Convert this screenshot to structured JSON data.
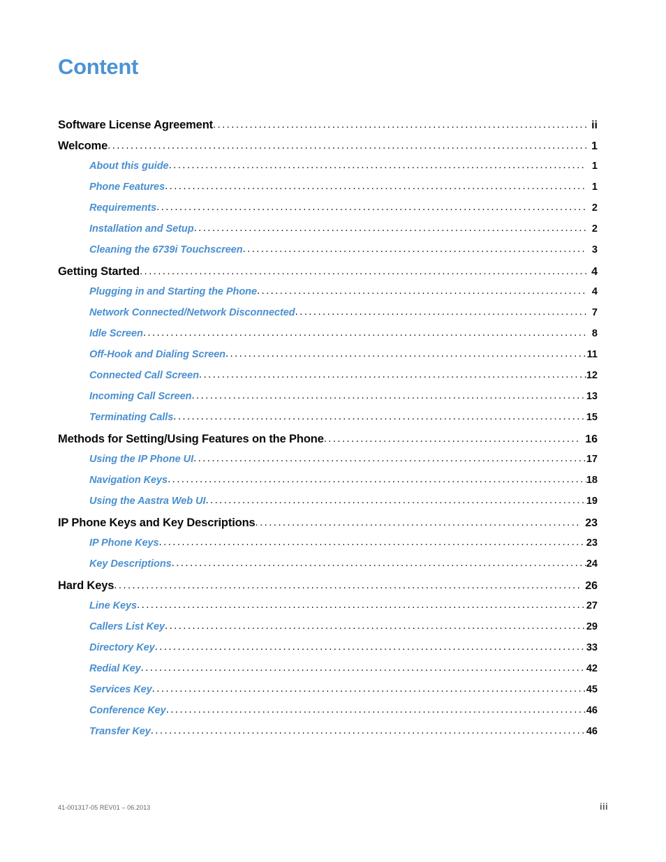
{
  "page": {
    "title": "Content",
    "title_color": "#4c93d3",
    "link_color": "#4a8fd0",
    "heading_color": "#0a0a0a",
    "background": "#ffffff"
  },
  "toc": {
    "entries": [
      {
        "level": 1,
        "label": "Software License Agreement",
        "page": "ii",
        "gap_before_page": false
      },
      {
        "level": 1,
        "label": "Welcome",
        "page": "1",
        "gap_before_page": false
      },
      {
        "level": 2,
        "label": "About this guide",
        "page": "1",
        "gap_before_page": false
      },
      {
        "level": 2,
        "label": "Phone Features",
        "page": "1",
        "gap_before_page": false
      },
      {
        "level": 2,
        "label": "Requirements",
        "page": "2",
        "gap_before_page": false
      },
      {
        "level": 2,
        "label": "Installation and Setup",
        "page": "2",
        "gap_before_page": false
      },
      {
        "level": 2,
        "label": "Cleaning the 6739i Touchscreen",
        "page": "3",
        "gap_before_page": false
      },
      {
        "level": 1,
        "label": "Getting Started",
        "page": "4",
        "gap_before_page": false
      },
      {
        "level": 2,
        "label": "Plugging in and Starting the Phone",
        "page": "4",
        "gap_before_page": false
      },
      {
        "level": 2,
        "label": "Network Connected/Network Disconnected",
        "page": "7",
        "gap_before_page": false
      },
      {
        "level": 2,
        "label": "Idle Screen",
        "page": "8",
        "gap_before_page": false
      },
      {
        "level": 2,
        "label": "Off-Hook and Dialing Screen",
        "page": "11",
        "gap_before_page": false
      },
      {
        "level": 2,
        "label": "Connected Call Screen",
        "page": "12",
        "gap_before_page": false
      },
      {
        "level": 2,
        "label": "Incoming Call Screen",
        "page": "13",
        "gap_before_page": false
      },
      {
        "level": 2,
        "label": "Terminating Calls",
        "page": "15",
        "gap_before_page": false
      },
      {
        "level": 1,
        "label": "Methods for Setting/Using Features on the Phone",
        "page": "16",
        "gap_before_page": true
      },
      {
        "level": 2,
        "label": "Using the IP Phone UI",
        "page": "17",
        "gap_before_page": false
      },
      {
        "level": 2,
        "label": "Navigation Keys",
        "page": "18",
        "gap_before_page": false
      },
      {
        "level": 2,
        "label": "Using the Aastra Web UI",
        "page": "19",
        "gap_before_page": false
      },
      {
        "level": 1,
        "label": "IP Phone Keys and Key Descriptions",
        "page": "23",
        "gap_before_page": true
      },
      {
        "level": 2,
        "label": "IP Phone Keys",
        "page": "23",
        "gap_before_page": false
      },
      {
        "level": 2,
        "label": "Key Descriptions",
        "page": "24",
        "gap_before_page": false
      },
      {
        "level": 1,
        "label": "Hard Keys",
        "page": "26",
        "gap_before_page": true
      },
      {
        "level": 2,
        "label": "Line Keys",
        "page": "27",
        "gap_before_page": false
      },
      {
        "level": 2,
        "label": "Callers List Key",
        "page": "29",
        "gap_before_page": false
      },
      {
        "level": 2,
        "label": "Directory Key",
        "page": "33",
        "gap_before_page": false
      },
      {
        "level": 2,
        "label": "Redial Key",
        "page": "42",
        "gap_before_page": false
      },
      {
        "level": 2,
        "label": "Services Key",
        "page": "45",
        "gap_before_page": false
      },
      {
        "level": 2,
        "label": "Conference Key",
        "page": "46",
        "gap_before_page": false
      },
      {
        "level": 2,
        "label": "Transfer Key",
        "page": "46",
        "gap_before_page": false
      }
    ],
    "leader_character": "."
  },
  "footer": {
    "document_id": "41-001317-05 REV01 – 06.2013",
    "folio": "iii"
  }
}
